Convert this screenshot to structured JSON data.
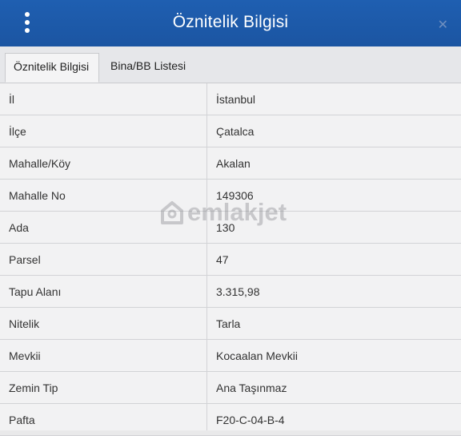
{
  "header": {
    "title": "Öznitelik Bilgisi",
    "menu_icon": "vertical-ellipsis-icon",
    "close_icon": "close-icon",
    "close_glyph": "✕"
  },
  "tabs": [
    {
      "label": "Öznitelik Bilgisi",
      "active": true
    },
    {
      "label": "Bina/BB Listesi",
      "active": false
    }
  ],
  "rows": [
    {
      "key": "İl",
      "value": "İstanbul"
    },
    {
      "key": "İlçe",
      "value": "Çatalca"
    },
    {
      "key": "Mahalle/Köy",
      "value": "Akalan"
    },
    {
      "key": "Mahalle No",
      "value": "149306"
    },
    {
      "key": "Ada",
      "value": "130"
    },
    {
      "key": "Parsel",
      "value": "47"
    },
    {
      "key": "Tapu Alanı",
      "value": "3.315,98"
    },
    {
      "key": "Nitelik",
      "value": "Tarla"
    },
    {
      "key": "Mevkii",
      "value": "Kocaalan Mevkii"
    },
    {
      "key": "Zemin Tip",
      "value": "Ana Taşınmaz"
    },
    {
      "key": "Pafta",
      "value": "F20-C-04-B-4"
    }
  ],
  "watermark": {
    "text": "emlakjet"
  },
  "colors": {
    "header": "#1d5aaa",
    "background": "#f2f2f3",
    "border": "#d2d3d6"
  }
}
